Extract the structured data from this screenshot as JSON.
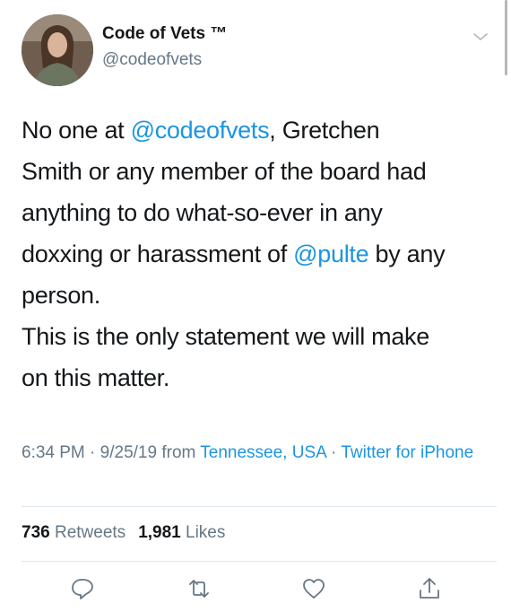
{
  "header": {
    "display_name": "Code of Vets ™",
    "handle": "@codeofvets",
    "avatar_icon": "profile-photo",
    "menu_icon": "chevron-down-icon"
  },
  "tweet": {
    "lines": [
      [
        {
          "t": "No one at "
        },
        {
          "t": "@codeofvets",
          "mention": true
        },
        {
          "t": ", Gretchen"
        }
      ],
      [
        {
          "t": "Smith or any member of the board had"
        }
      ],
      [
        {
          "t": "anything to do what-so-ever in any"
        }
      ],
      [
        {
          "t": "doxxing or harassment of "
        },
        {
          "t": "@pulte",
          "mention": true
        },
        {
          "t": " by any"
        }
      ],
      [
        {
          "t": "person."
        }
      ],
      [
        {
          "t": "This is the only statement we will make"
        }
      ],
      [
        {
          "t": "on this matter."
        }
      ]
    ]
  },
  "meta": {
    "time": "6:34 PM",
    "sep1": " · ",
    "date": "9/25/19",
    "from": " from ",
    "location": "Tennessee, USA",
    "sep2": " · ",
    "source": "Twitter for iPhone"
  },
  "stats": {
    "retweets_count": "736",
    "retweets_label": " Retweets",
    "likes_count": "1,981",
    "likes_label": " Likes"
  },
  "actions": {
    "icons": [
      "reply-icon",
      "retweet-icon",
      "like-icon",
      "share-icon"
    ]
  },
  "colors": {
    "link": "#1b95e0",
    "secondary": "#657786",
    "text": "#14171a",
    "divider": "#e1e8ed"
  }
}
